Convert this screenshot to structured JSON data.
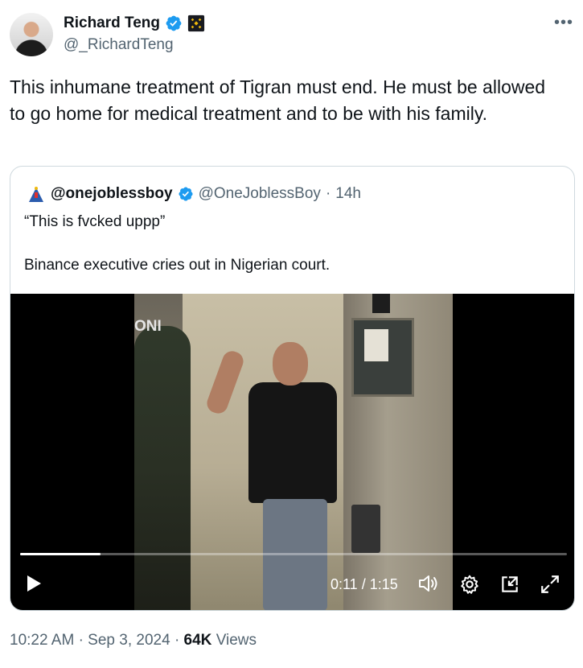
{
  "author": {
    "display_name": "Richard Teng",
    "handle": "@_RichardTeng",
    "verified_icon": "verified-badge-icon",
    "affiliate_icon": "binance-logo-icon"
  },
  "tweet": {
    "text": "This inhumane treatment of Tigran must end. He must be allowed to go home for medical treatment and to be with his family."
  },
  "quoted": {
    "display_name": "@onejoblessboy",
    "handle": "@OneJoblessBoy",
    "separator": "·",
    "age": "14h",
    "line1": "“This is fvcked uppp”",
    "line2": "Binance executive cries out in Nigerian court."
  },
  "video": {
    "watermark": "ONI",
    "time": "0:11 / 1:15",
    "progress_fraction": 0.147
  },
  "footer": {
    "time": "10:22 AM",
    "sep1": "·",
    "date": "Sep 3, 2024",
    "sep2": "·",
    "views_count": "64K",
    "views_label": "Views"
  },
  "colors": {
    "accent": "#1d9bf0",
    "secondary_text": "#536471",
    "binance_yellow": "#f0b90b"
  }
}
